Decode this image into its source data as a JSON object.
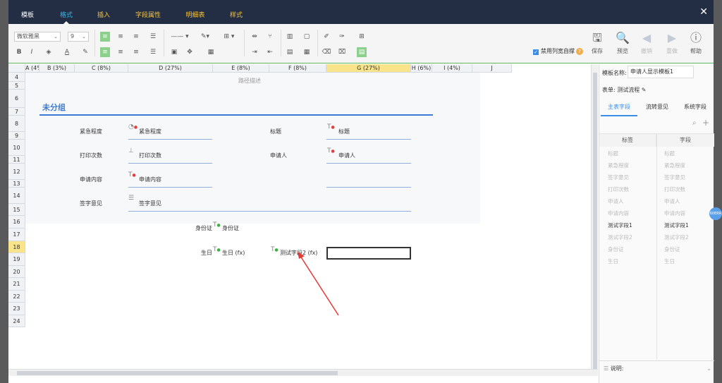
{
  "tabs": [
    "模板",
    "格式",
    "插入",
    "字段属性",
    "明细表",
    "样式"
  ],
  "toolbar": {
    "font": "微软雅黑",
    "size": "9",
    "buttons": {
      "save": "保存",
      "preview": "预览",
      "undo": "撤销",
      "redo": "重做",
      "help": "帮助"
    },
    "wrap_label": "禁用列宽自撑"
  },
  "columns": [
    "A (4%)",
    "B (3%)",
    "C (8%)",
    "D (27%)",
    "E (8%)",
    "F (8%)",
    "G (27%)",
    "H (6%)",
    "I (4%)",
    "J"
  ],
  "rows": [
    "4",
    "5",
    "6",
    "7",
    "8",
    "9",
    "10",
    "11",
    "12",
    "13",
    "14",
    "15",
    "16",
    "17",
    "18",
    "19",
    "20",
    "21",
    "22",
    "23",
    "24"
  ],
  "form": {
    "path_desc": "路径描述",
    "group_title": "未分组",
    "urgency_label": "紧急程度",
    "urgency_field": "紧急程度",
    "title_label": "标题",
    "title_field": "标题",
    "print_label": "打印次数",
    "print_field": "打印次数",
    "applicant_label": "申请人",
    "applicant_field": "申请人",
    "content_label": "申请内容",
    "content_field": "申请内容",
    "opinion_label": "签字意见",
    "opinion_field": "签字意见",
    "id_label": "身份证",
    "id_field": "身份证",
    "birthday_label": "生日",
    "birthday_field": "生日 (fx)",
    "test_field": "测试字段2 (fx)"
  },
  "side": {
    "template_name_label": "模板名称:",
    "template_name": "申请人显示模板1",
    "form_label": "表单: 测试流程",
    "tabs": [
      "主表字段",
      "流转意见",
      "系统字段"
    ],
    "col_label": "标签",
    "col_field": "字段",
    "fields": [
      {
        "label": "标题",
        "field": "标题",
        "strong": false
      },
      {
        "label": "紧急程度",
        "field": "紧急程度",
        "strong": false
      },
      {
        "label": "签字意见",
        "field": "签字意见",
        "strong": false
      },
      {
        "label": "打印次数",
        "field": "打印次数",
        "strong": false
      },
      {
        "label": "申请人",
        "field": "申请人",
        "strong": false
      },
      {
        "label": "申请内容",
        "field": "申请内容",
        "strong": false
      },
      {
        "label": "测试字段1",
        "field": "测试字段1",
        "strong": true
      },
      {
        "label": "测试字段2",
        "field": "测试字段2",
        "strong": false
      },
      {
        "label": "身份证",
        "field": "身份证",
        "strong": false
      },
      {
        "label": "生日",
        "field": "生日",
        "strong": false
      }
    ],
    "desc_label": "说明:"
  },
  "badge": "60ERR",
  "colors": {
    "header": "#232e45",
    "accent": "#3a8ee6",
    "selected": "#f9e48c"
  }
}
